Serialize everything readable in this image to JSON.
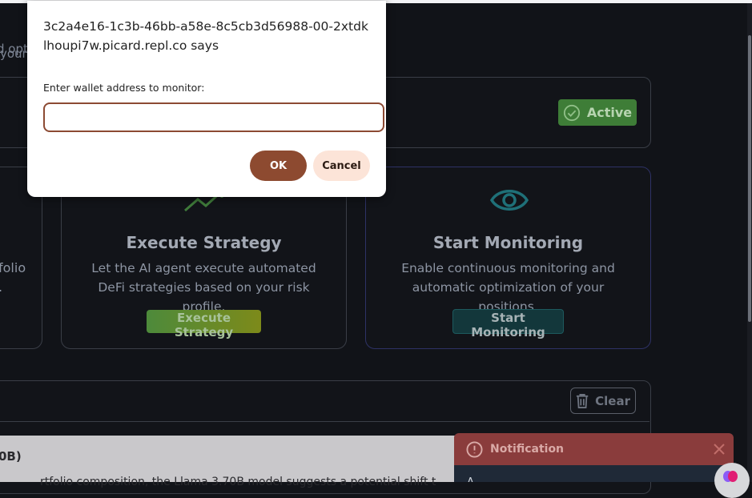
{
  "background": {
    "subtitle_fragment": "d opt",
    "status_fragment": "your l",
    "active_badge": "Active",
    "left_card_fragment_1": "folio",
    "left_card_fragment_2": ".",
    "execute_card": {
      "title": "Execute Strategy",
      "description": "Let the AI agent execute automated DeFi strategies based on your risk profile.",
      "button": "Execute Strategy"
    },
    "monitor_card": {
      "title": "Start Monitoring",
      "description": "Enable continuous monitoring and automatic optimization of your positions.",
      "button": "Start Monitoring"
    },
    "log_panel": {
      "clear_label": "Clear",
      "entry_title_fragment": "0B)",
      "entry_text_fragment": "rtfolio composition, the Llama 3.70B model suggests a potential shift t"
    },
    "notification": {
      "title": "Notification",
      "body_fragment": "A"
    }
  },
  "dialog": {
    "origin": "3c2a4e16-1c3b-46bb-a58e-8c5cb3d56988-00-2xtdklhoupi7w.picard.repl.co says",
    "message": "Enter wallet address to monitor:",
    "input_value": "",
    "ok_label": "OK",
    "cancel_label": "Cancel"
  },
  "colors": {
    "page_bg": "#111318",
    "active_green": "#3e7d37",
    "notification_red": "#8a3c3c",
    "dialog_ok": "#8d4a30",
    "dialog_cancel": "#fce4d8"
  }
}
